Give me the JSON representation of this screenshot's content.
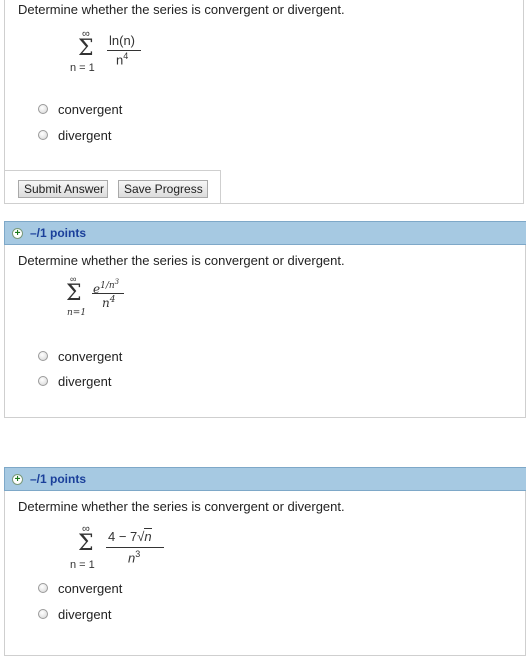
{
  "q1": {
    "question": "Determine whether the series is convergent or divergent.",
    "sum_top": "∞",
    "sum_bottom": "n = 1",
    "numerator": "ln(n)",
    "denominator_base": "n",
    "denominator_exp": "4",
    "options": [
      "convergent",
      "divergent"
    ],
    "submit_label": "Submit Answer",
    "save_label": "Save Progress"
  },
  "q2": {
    "points": "–/1 points",
    "question": "Determine whether the series is convergent or divergent.",
    "sum_top": "∞",
    "sum_bottom": "n=1",
    "numerator_base": "e",
    "numerator_exp": "1/n",
    "numerator_exp_exp": "3",
    "denominator_base": "n",
    "denominator_exp": "4",
    "options": [
      "convergent",
      "divergent"
    ]
  },
  "q3": {
    "points": "–/1 points",
    "question": "Determine whether the series is convergent or divergent.",
    "sum_top": "∞",
    "sum_bottom": "n = 1",
    "numerator_prefix": "4 − 7",
    "numerator_radicand": "n",
    "denominator_base": "n",
    "denominator_exp": "3",
    "options": [
      "convergent",
      "divergent"
    ]
  },
  "colors": {
    "bar_bg": "#a6c9e2",
    "points_text": "#1a3f9a",
    "plus_icon": "#1c7a1c"
  }
}
